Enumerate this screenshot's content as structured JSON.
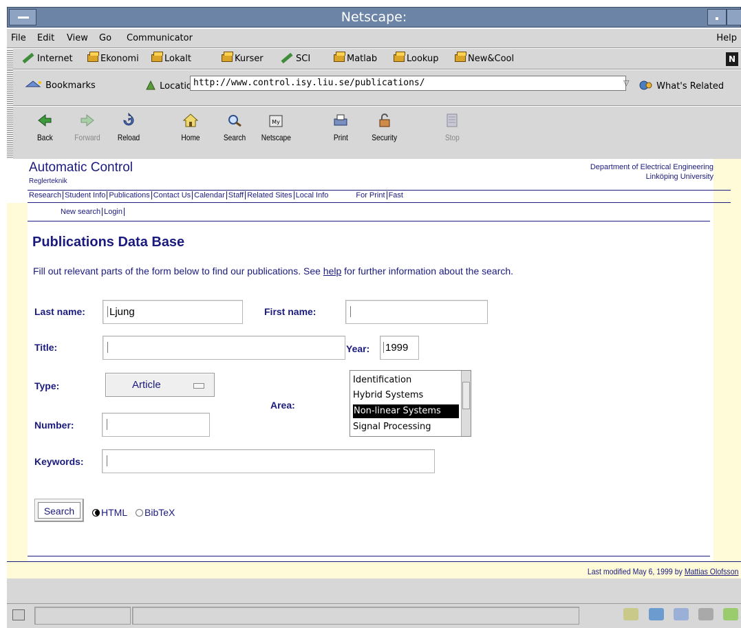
{
  "window": {
    "title": "Netscape:"
  },
  "menu": [
    "File",
    "Edit",
    "View",
    "Go",
    "Communicator"
  ],
  "menu_help": "Help",
  "personal_toolbar": [
    {
      "label": "Internet",
      "icon": "pen-icon"
    },
    {
      "label": "Ekonomi",
      "icon": "folder-icon"
    },
    {
      "label": "Lokalt",
      "icon": "folder-icon"
    },
    {
      "label": "Kurser",
      "icon": "folder-icon"
    },
    {
      "label": "SCI",
      "icon": "pen-icon"
    },
    {
      "label": "Matlab",
      "icon": "folder-icon"
    },
    {
      "label": "Lookup",
      "icon": "folder-icon"
    },
    {
      "label": "New&Cool",
      "icon": "folder-icon"
    }
  ],
  "location": {
    "bookmarks_label": "Bookmarks",
    "location_label": "Location:",
    "url": "http://www.control.isy.liu.se/publications/",
    "related_label": "What's Related"
  },
  "toolbar": [
    {
      "label": "Back",
      "icon": "back-arrow-icon",
      "enabled": true
    },
    {
      "label": "Forward",
      "icon": "forward-arrow-icon",
      "enabled": false
    },
    {
      "label": "Reload",
      "icon": "reload-icon",
      "enabled": true
    },
    {
      "label": "Home",
      "icon": "home-icon",
      "enabled": true
    },
    {
      "label": "Search",
      "icon": "search-icon",
      "enabled": true
    },
    {
      "label": "Netscape",
      "icon": "netscape-icon",
      "enabled": true
    },
    {
      "label": "Print",
      "icon": "print-icon",
      "enabled": true
    },
    {
      "label": "Security",
      "icon": "security-lock-icon",
      "enabled": true
    },
    {
      "label": "Stop",
      "icon": "stop-icon",
      "enabled": false
    }
  ],
  "site": {
    "title": "Automatic Control",
    "subtitle": "Reglerteknik",
    "dept_line1": "Department of Electrical Engineering",
    "dept_line2": "Linköping University",
    "nav": [
      "Research",
      "Student Info",
      "Publications",
      "Contact Us",
      "Calendar",
      "Staff",
      "Related Sites",
      "Local Info"
    ],
    "nav_right": [
      "For Print",
      "Fast"
    ],
    "subnav": [
      "New search",
      "Login"
    ]
  },
  "form": {
    "heading": "Publications Data Base",
    "intro_before": "Fill out relevant parts of the form below to find our publications. See ",
    "intro_link": "help",
    "intro_after": " for further information about the search.",
    "last_name_label": "Last name:",
    "last_name_value": "Ljung",
    "first_name_label": "First name:",
    "first_name_value": "",
    "title_label": "Title:",
    "title_value": "",
    "year_label": "Year:",
    "year_value": "1999",
    "type_label": "Type:",
    "type_value": "Article",
    "area_label": "Area:",
    "area_options": [
      "Identification",
      "Hybrid Systems",
      "Non-linear Systems",
      "Signal Processing"
    ],
    "area_selected": "Non-linear Systems",
    "number_label": "Number:",
    "number_value": "",
    "keywords_label": "Keywords:",
    "keywords_value": "",
    "search_button": "Search",
    "format_options": [
      "HTML",
      "BibTeX"
    ],
    "format_selected": "HTML"
  },
  "footer": {
    "modified_text": "Last modified May 6, 1999 by ",
    "author_link": "Mattias Olofsson"
  },
  "colors": {
    "page_text": "#1a1a7e",
    "chrome": "#d7d7d7",
    "titlebar": "#6c84a6",
    "sidebar_yellow": "#fffbd9"
  }
}
